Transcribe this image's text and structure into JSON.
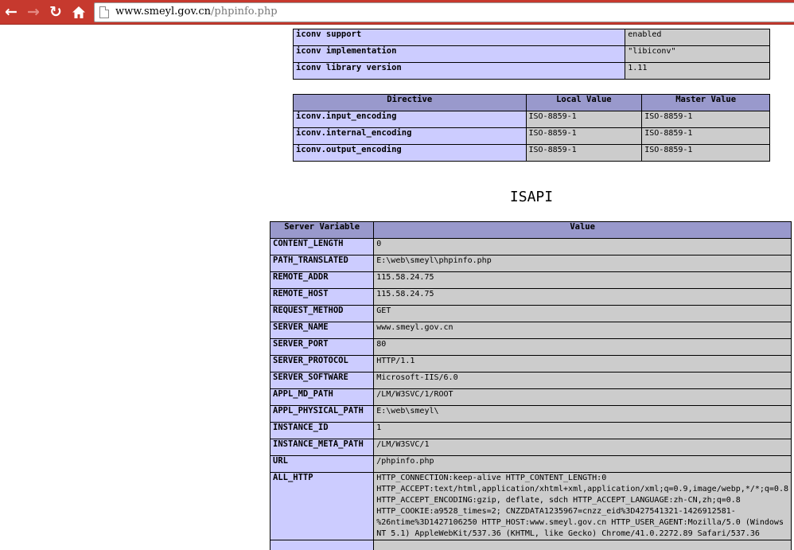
{
  "browser": {
    "url_host": "www.smeyl.gov.cn",
    "url_path": "/phpinfo.php"
  },
  "iconv_general": [
    {
      "name": "iconv support",
      "value": "enabled"
    },
    {
      "name": "iconv implementation",
      "value": "\"libiconv\""
    },
    {
      "name": "iconv library version",
      "value": "1.11"
    }
  ],
  "iconv_directives": {
    "headers": [
      "Directive",
      "Local Value",
      "Master Value"
    ],
    "rows": [
      {
        "name": "iconv.input_encoding",
        "local": "ISO-8859-1",
        "master": "ISO-8859-1"
      },
      {
        "name": "iconv.internal_encoding",
        "local": "ISO-8859-1",
        "master": "ISO-8859-1"
      },
      {
        "name": "iconv.output_encoding",
        "local": "ISO-8859-1",
        "master": "ISO-8859-1"
      }
    ]
  },
  "isapi": {
    "title": "ISAPI",
    "headers": [
      "Server Variable",
      "Value"
    ],
    "rows": [
      {
        "name": "CONTENT_LENGTH",
        "value": "0"
      },
      {
        "name": "PATH_TRANSLATED",
        "value": "E:\\web\\smeyl\\phpinfo.php"
      },
      {
        "name": "REMOTE_ADDR",
        "value": "115.58.24.75"
      },
      {
        "name": "REMOTE_HOST",
        "value": "115.58.24.75"
      },
      {
        "name": "REQUEST_METHOD",
        "value": "GET"
      },
      {
        "name": "SERVER_NAME",
        "value": "www.smeyl.gov.cn"
      },
      {
        "name": "SERVER_PORT",
        "value": "80"
      },
      {
        "name": "SERVER_PROTOCOL",
        "value": "HTTP/1.1"
      },
      {
        "name": "SERVER_SOFTWARE",
        "value": "Microsoft-IIS/6.0"
      },
      {
        "name": "APPL_MD_PATH",
        "value": "/LM/W3SVC/1/ROOT"
      },
      {
        "name": "APPL_PHYSICAL_PATH",
        "value": "E:\\web\\smeyl\\"
      },
      {
        "name": "INSTANCE_ID",
        "value": "1"
      },
      {
        "name": "INSTANCE_META_PATH",
        "value": "/LM/W3SVC/1"
      },
      {
        "name": "URL",
        "value": "/phpinfo.php"
      }
    ],
    "all_http": {
      "name": "ALL_HTTP",
      "lines": [
        "HTTP_CONNECTION:keep-alive HTTP_CONTENT_LENGTH:0",
        "HTTP_ACCEPT:text/html,application/xhtml+xml,application/xml;q=0.9,image/webp,*/*;q=0.8",
        "HTTP_ACCEPT_ENCODING:gzip, deflate, sdch HTTP_ACCEPT_LANGUAGE:zh-CN,zh;q=0.8",
        "HTTP_COOKIE:a9528_times=2; CNZZDATA1235967=cnzz_eid%3D427541321-1426912581-",
        "%26ntime%3D1427106250 HTTP_HOST:www.smeyl.gov.cn HTTP_USER_AGENT:Mozilla/5.0 (Windows",
        "NT 5.1) AppleWebKit/537.36 (KHTML, like Gecko) Chrome/41.0.2272.89 Safari/537.36"
      ]
    }
  },
  "colors": {
    "toolbar": "#c6392e",
    "header_bg": "#9999cc",
    "label_bg": "#ccccff",
    "value_bg": "#cccccc"
  }
}
